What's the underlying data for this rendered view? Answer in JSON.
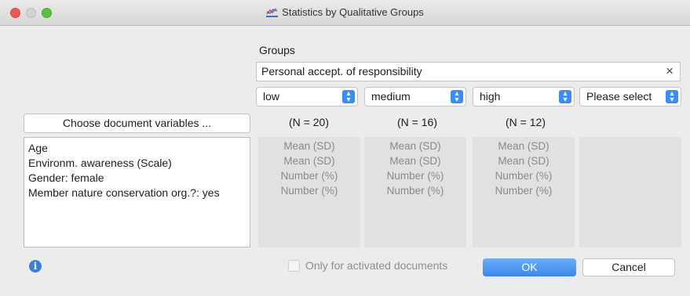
{
  "window": {
    "title": "Statistics by Qualitative Groups"
  },
  "groups": {
    "label": "Groups",
    "value": "Personal accept. of responsibility",
    "clear_icon": "×"
  },
  "selects": [
    {
      "value": "low"
    },
    {
      "value": "medium"
    },
    {
      "value": "high"
    },
    {
      "value": "Please select"
    }
  ],
  "choose_button": "Choose document variables ...",
  "counts": [
    "(N = 20)",
    "(N = 16)",
    "(N = 12)"
  ],
  "variables": [
    "Age",
    "Environm. awareness (Scale)",
    "Gender: female",
    "Member nature conservation org.?: yes"
  ],
  "columns": [
    [
      "Mean (SD)",
      "Mean (SD)",
      "Number (%)",
      "Number (%)"
    ],
    [
      "Mean (SD)",
      "Mean (SD)",
      "Number (%)",
      "Number (%)"
    ],
    [
      "Mean (SD)",
      "Mean (SD)",
      "Number (%)",
      "Number (%)"
    ]
  ],
  "footer": {
    "only_activated": "Only for activated documents",
    "ok": "OK",
    "cancel": "Cancel",
    "info_icon": "i"
  },
  "colors": {
    "accent": "#3b8cf5",
    "ok_button": "#4a93f0",
    "info": "#3b7fd4"
  }
}
